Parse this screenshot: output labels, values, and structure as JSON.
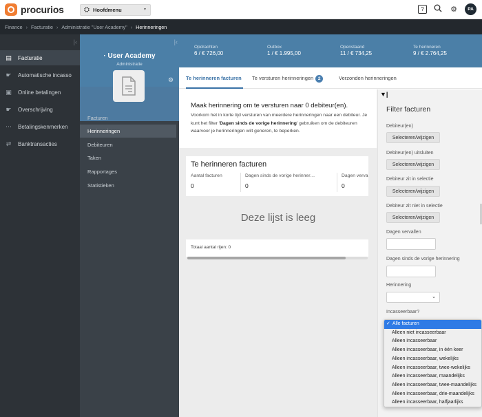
{
  "app": {
    "brand": "procurios",
    "menu_label": "Hoofdmenu",
    "user_initials": "PA"
  },
  "breadcrumb": [
    "Finance",
    "Facturatie",
    "Administratie \"User Academy\"",
    "Herinneringen"
  ],
  "left_nav": [
    {
      "label": "Facturatie",
      "icon": "invoice-icon",
      "active": true
    },
    {
      "label": "Automatische incasso",
      "icon": "hand-coins-icon",
      "active": false
    },
    {
      "label": "Online betalingen",
      "icon": "card-icon",
      "active": false
    },
    {
      "label": "Overschrijving",
      "icon": "hand-coins-icon",
      "active": false
    },
    {
      "label": "Betalingskenmerken",
      "icon": "code-icon",
      "active": false
    },
    {
      "label": "Banktransacties",
      "icon": "transfer-icon",
      "active": false
    }
  ],
  "admin": {
    "name": "User Academy",
    "subtitle": "Administratie",
    "items": [
      {
        "label": "Facturen",
        "active": false
      },
      {
        "label": "Herinneringen",
        "active": true
      },
      {
        "label": "Debiteuren",
        "active": false
      },
      {
        "label": "Taken",
        "active": false
      },
      {
        "label": "Rapportages",
        "active": false
      },
      {
        "label": "Statistieken",
        "active": false
      }
    ]
  },
  "stats": [
    {
      "label": "Opdrachten",
      "value": "6 / € 726,00"
    },
    {
      "label": "Outbox",
      "value": "1 / € 1.995,00"
    },
    {
      "label": "Openstaand",
      "value": "11 / € 734,25"
    },
    {
      "label": "Te herinneren",
      "value": "9 / € 2.764,25"
    }
  ],
  "tabs": [
    {
      "label": "Te herinneren facturen",
      "active": true,
      "badge": ""
    },
    {
      "label": "Te versturen herinneringen",
      "active": false,
      "badge": "2"
    },
    {
      "label": "Verzonden herinneringen",
      "active": false,
      "badge": ""
    }
  ],
  "info": {
    "title_prefix": "Maak herinnering om te versturen naar ",
    "title_count": "0 debiteur(en).",
    "body_1": "Voorkom het in korte tijd versturen van meerdere herinneringen naar een debiteur. Je kunt het filter '",
    "body_bold": "Dagen sinds de vorige herinnering",
    "body_2": "' gebruiken om de debiteuren waarvoor je herinneringen wilt generen, te beperken."
  },
  "list": {
    "title": "Te herinneren facturen",
    "columns": [
      {
        "header": "Aantal facturen",
        "value": "0"
      },
      {
        "header": "Dagen sinds de vorige herinner…",
        "value": "0"
      },
      {
        "header": "Dagen verva",
        "value": "0"
      }
    ],
    "empty_text": "Deze lijst is leeg",
    "total_label": "Totaal aantal rijen: 0"
  },
  "filter": {
    "title": "Filter facturen",
    "debiteuren_label": "Debiteur(en)",
    "debiteuren_uitsluiten_label": "Debiteur(en) uitsluiten",
    "in_selectie_label": "Debiteur zit in selectie",
    "niet_in_selectie_label": "Debiteur zit niet in selectie",
    "select_button": "Selecteren/wijzigen",
    "dagen_vervallen_label": "Dagen vervallen",
    "dagen_sinds_label": "Dagen sinds de vorige herinnering",
    "herinnering_label": "Herinnering",
    "incasseerbaar_label": "Incasseerbaar?",
    "incasseerbaar_options": [
      "Alle facturen",
      "Alleen niet incasseerbaar",
      "Alleen incasseerbaar",
      "Alleen incasseerbaar, in één keer",
      "Alleen incasseerbaar, wekelijks",
      "Alleen incasseerbaar, twee-wekelijks",
      "Alleen incasseerbaar, maandelijks",
      "Alleen incasseerbaar, twee-maandelijks",
      "Alleen incasseerbaar, drie-maandelijks",
      "Alleen incasseerbaar, halfjaarlijks"
    ],
    "incasseerbaar_selected": "Alle facturen"
  },
  "colors": {
    "accent": "#4b7fa7",
    "dark_nav": "#2d3237",
    "brand_orange": "#f07d32",
    "select_blue": "#2f7be5"
  }
}
